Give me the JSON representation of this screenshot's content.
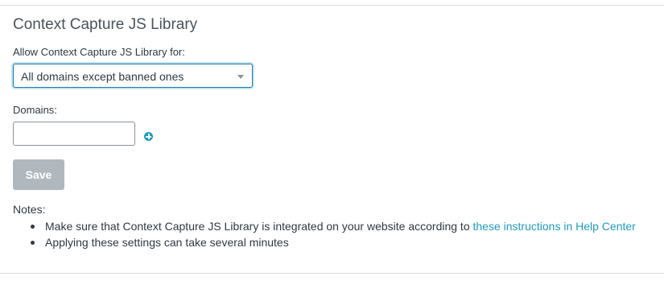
{
  "section": {
    "title": "Context Capture JS Library"
  },
  "allow_field": {
    "label": "Allow Context Capture JS Library for:",
    "selected": "All domains except banned ones"
  },
  "domains_field": {
    "label": "Domains:",
    "value": "",
    "add_icon": "plus-circle-icon"
  },
  "save_button": {
    "label": "Save",
    "enabled": false
  },
  "notes": {
    "label": "Notes:",
    "items": [
      {
        "text": "Make sure that Context Capture JS Library is integrated on your website according to ",
        "link": "these instructions in Help Center"
      },
      {
        "text": "Applying these settings can take several minutes"
      }
    ]
  },
  "colors": {
    "link": "#1f9bc0",
    "focus_border": "#1f73b7",
    "disabled_button": "#b0b8be",
    "text": "#2f3941"
  }
}
